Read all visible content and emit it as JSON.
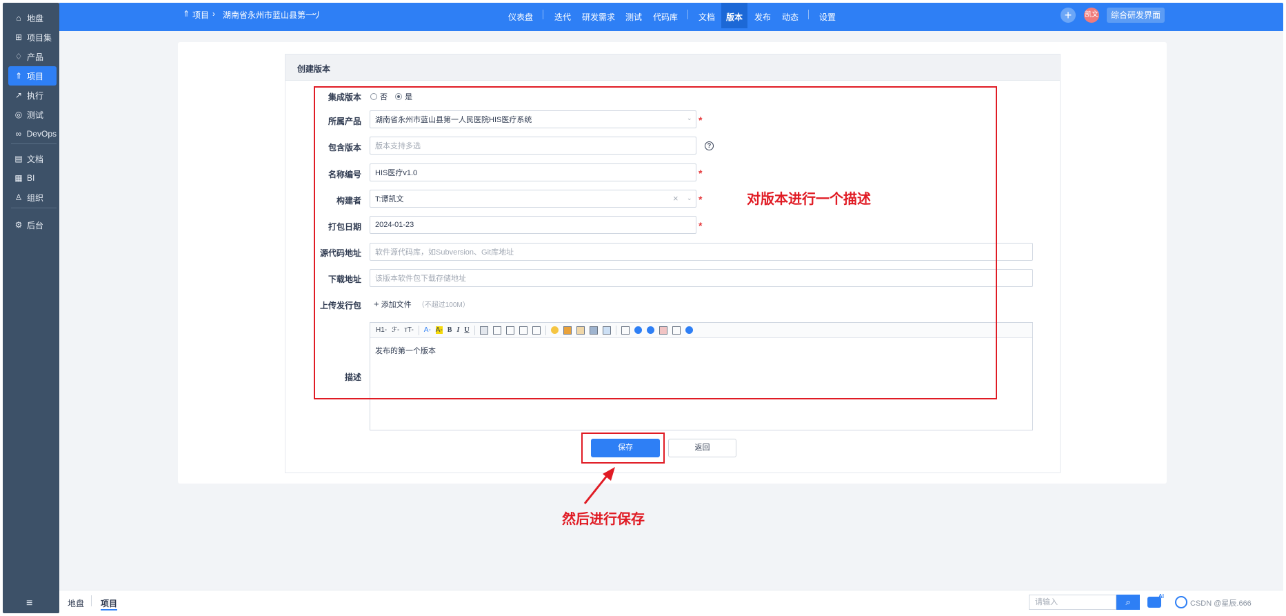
{
  "sidebar": {
    "items": [
      {
        "icon": "home-icon",
        "glyph": "⌂",
        "label": "地盘"
      },
      {
        "icon": "grid-icon",
        "glyph": "⊞",
        "label": "项目集"
      },
      {
        "icon": "bulb-icon",
        "glyph": "♢",
        "label": "产品"
      },
      {
        "icon": "rocket-icon",
        "glyph": "⇑",
        "label": "项目"
      },
      {
        "icon": "run-icon",
        "glyph": "↗",
        "label": "执行"
      },
      {
        "icon": "test-icon",
        "glyph": "◎",
        "label": "测试"
      },
      {
        "icon": "infinity-icon",
        "glyph": "∞",
        "label": "DevOps"
      },
      {
        "icon": "doc-icon",
        "glyph": "▤",
        "label": "文档"
      },
      {
        "icon": "bi-icon",
        "glyph": "▦",
        "label": "BI"
      },
      {
        "icon": "org-icon",
        "glyph": "♙",
        "label": "组织"
      },
      {
        "icon": "gear-icon",
        "glyph": "⚙",
        "label": "后台"
      }
    ],
    "active_index": 3,
    "collapse_glyph": "≡"
  },
  "header": {
    "crumb_icon": "⇑",
    "crumb_root": "项目",
    "crumb_arrow": "›",
    "crumb_project": "湖南省永州市蓝山县第一丿",
    "crumb_caret": "⌄",
    "nav": [
      "仪表盘",
      "迭代",
      "研发需求",
      "测试",
      "代码库",
      "文档",
      "版本",
      "发布",
      "动态",
      "设置"
    ],
    "active_nav": "版本",
    "plus_glyph": "+",
    "avatar_text": "凯文",
    "switch_button": "综合研发界面"
  },
  "form": {
    "title": "创建版本",
    "integrated": {
      "label": "集成版本",
      "options": [
        "否",
        "是"
      ],
      "selected": "是"
    },
    "product": {
      "label": "所属产品",
      "value": "湖南省永州市蓝山县第一人民医院HIS医疗系统"
    },
    "included": {
      "label": "包含版本",
      "placeholder": "版本支持多选"
    },
    "name": {
      "label": "名称编号",
      "value": "HIS医疗v1.0"
    },
    "builder": {
      "label": "构建者",
      "value": "T:谭凯文"
    },
    "date": {
      "label": "打包日期",
      "value": "2024-01-23"
    },
    "source": {
      "label": "源代码地址",
      "placeholder": "软件源代码库，如Subversion、Git库地址"
    },
    "download": {
      "label": "下载地址",
      "placeholder": "该版本软件包下载存储地址"
    },
    "upload": {
      "label": "上传发行包",
      "add_icon": "+",
      "add_label": "添加文件",
      "hint": "（不超过100M）"
    },
    "description": {
      "label": "描述",
      "content": "发布的第一个版本"
    },
    "required_mark": "*",
    "help_glyph": "?",
    "caret_glyph": "⌄",
    "clear_glyph": "×",
    "save_label": "保存",
    "back_label": "返回"
  },
  "editor_toolbar": [
    "H1-",
    "ℱ-",
    "тT-",
    "A-",
    "A-",
    "B",
    "I",
    "U"
  ],
  "annotations": {
    "describe": "对版本进行一个描述",
    "save": "然后进行保存",
    "color": "#e01b24"
  },
  "footer": {
    "crumbs": [
      "地盘",
      "项目"
    ],
    "search_placeholder": "请输入",
    "search_glyph": "⌕",
    "ai_badge": "AI",
    "watermark": "CSDN @星辰.666"
  },
  "colors": {
    "primary": "#2e7ff5",
    "sidebar": "#3d5168",
    "required": "#e5383b"
  }
}
